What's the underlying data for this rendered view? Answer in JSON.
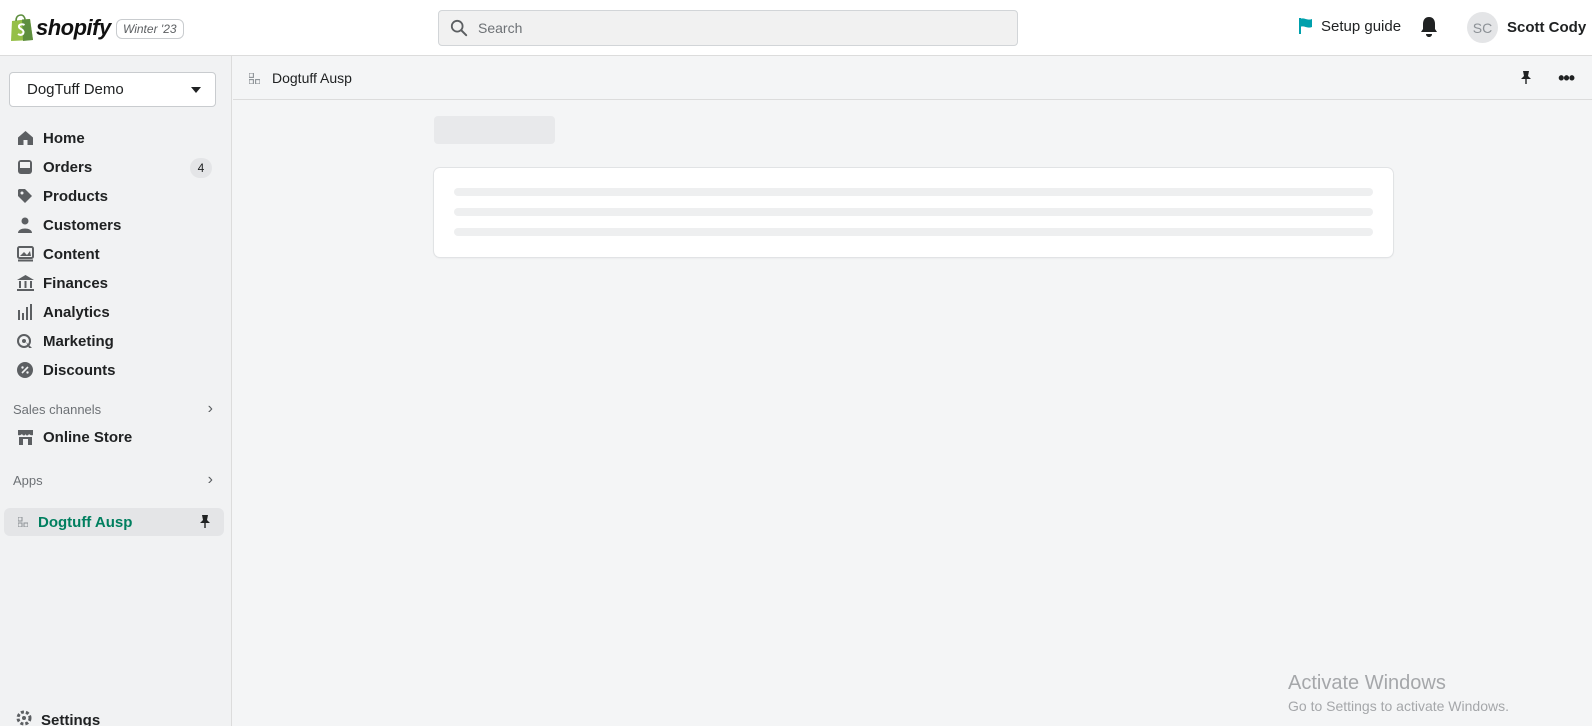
{
  "topbar": {
    "logo_text": "shopify",
    "edition": "Winter '23",
    "search_placeholder": "Search",
    "setup_guide": "Setup guide",
    "user_initials": "SC",
    "user_name": "Scott Cody",
    "accent_color": "#00a0ac"
  },
  "sidebar": {
    "store_name": "DogTuff Demo",
    "nav": [
      {
        "label": "Home",
        "icon": "home-icon"
      },
      {
        "label": "Orders",
        "icon": "orders-icon",
        "badge": "4"
      },
      {
        "label": "Products",
        "icon": "tag-icon"
      },
      {
        "label": "Customers",
        "icon": "person-icon"
      },
      {
        "label": "Content",
        "icon": "content-icon"
      },
      {
        "label": "Finances",
        "icon": "bank-icon"
      },
      {
        "label": "Analytics",
        "icon": "bar-chart-icon"
      },
      {
        "label": "Marketing",
        "icon": "target-icon"
      },
      {
        "label": "Discounts",
        "icon": "discount-icon"
      }
    ],
    "sales_channels_heading": "Sales channels",
    "online_store": "Online Store",
    "apps_heading": "Apps",
    "active_app": "Dogtuff Ausp",
    "settings": "Settings",
    "active_color": "#007f5f"
  },
  "main": {
    "app_title": "Dogtuff Ausp"
  },
  "watermark": {
    "line1": "Activate Windows",
    "line2": "Go to Settings to activate Windows."
  }
}
